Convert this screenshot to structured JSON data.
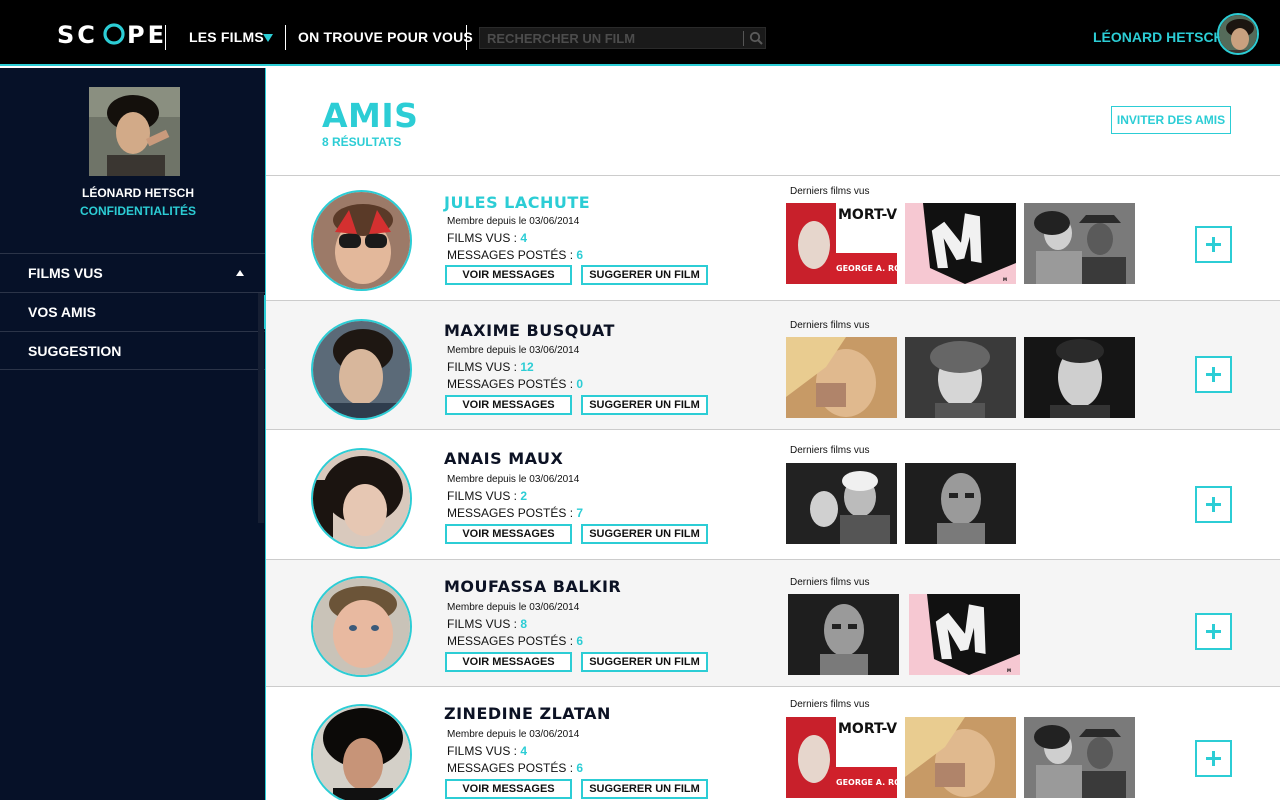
{
  "header": {
    "logo": "SCOPE",
    "nav_films": "LES FILMS",
    "nav_find": "ON TROUVE POUR VOUS",
    "search_placeholder": "RECHERCHER UN FILM",
    "user_name": "LÉONARD HETSCH"
  },
  "sidebar": {
    "profile_name": "LÉONARD HETSCH",
    "privacy": "CONFIDENTIALITÉS",
    "items": [
      {
        "label": "FILMS VUS"
      },
      {
        "label": "VOS AMIS"
      },
      {
        "label": "SUGGESTION"
      }
    ]
  },
  "main": {
    "title": "AMIS",
    "count": "8 RÉSULTATS",
    "invite_label": "INVITER DES AMIS",
    "labels": {
      "films_seen": "FILMS VUS : ",
      "messages_posted": "MESSAGES POSTÉS : ",
      "view_messages": "VOIR MESSAGES",
      "suggest_film": "SUGGERER UN FILM",
      "last_films": "Derniers films vus"
    },
    "friends": [
      {
        "name": "JULES LACHUTE",
        "since": "Membre depuis le 03/06/2014",
        "films": "4",
        "messages": "6"
      },
      {
        "name": "MAXIME BUSQUAT",
        "since": "Membre depuis le 03/06/2014",
        "films": "12",
        "messages": "0"
      },
      {
        "name": "ANAIS MAUX",
        "since": "Membre depuis le 03/06/2014",
        "films": "2",
        "messages": "7"
      },
      {
        "name": "MOUFASSA BALKIR",
        "since": "Membre depuis le 03/06/2014",
        "films": "8",
        "messages": "6"
      },
      {
        "name": "ZINEDINE ZLATAN",
        "since": "Membre depuis le 03/06/2014",
        "films": "4",
        "messages": "6"
      }
    ],
    "poster_texts": {
      "mort_vivant": "MORT-VIVANT!",
      "director": "GEORGE A. ROMERO",
      "m_letter": "M"
    }
  },
  "colors": {
    "accent": "#2ccdd5",
    "sidebar_bg": "#061128",
    "topbar_bg": "#000000"
  }
}
